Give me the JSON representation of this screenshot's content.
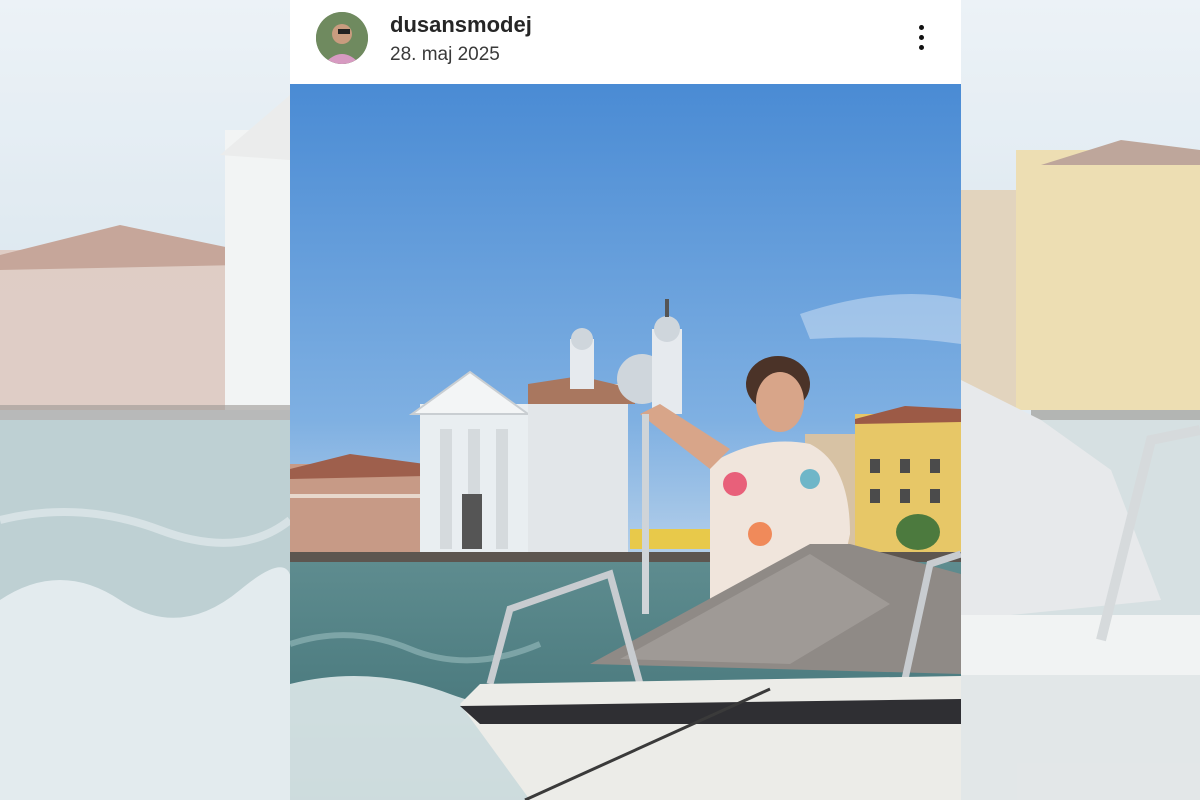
{
  "post": {
    "username": "dusansmodej",
    "date": "28. maj 2025",
    "avatar_icon": "profile-avatar",
    "more_icon": "more-vertical-icon"
  },
  "photo": {
    "scene": "venice-canal-boat-photo"
  },
  "colors": {
    "sky": "#4f8fd6",
    "water": "#4f7f82",
    "card": "#ffffff",
    "text": "#262626"
  }
}
